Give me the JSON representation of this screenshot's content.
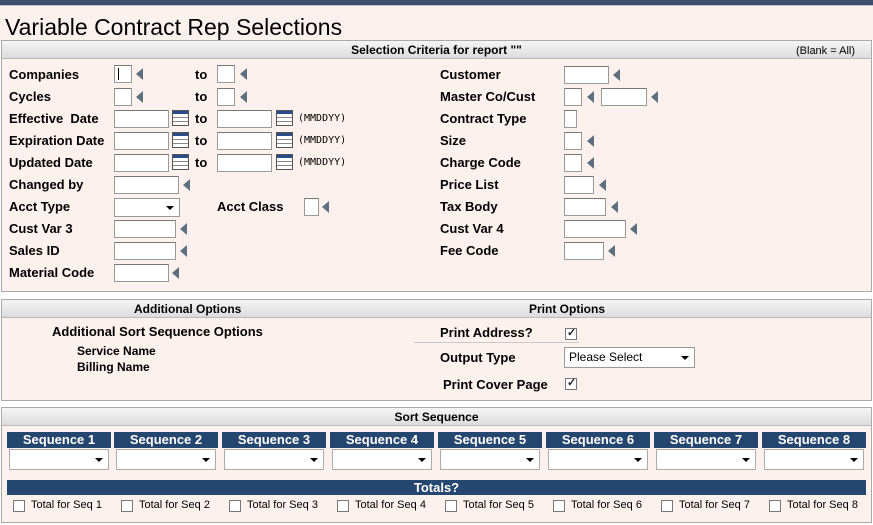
{
  "page_title": "Variable Contract Rep Selections",
  "criteria": {
    "header": "Selection Criteria for report \"\"",
    "blank_note": "(Blank = All)",
    "to": "to",
    "date_format": "(MMDDYY)",
    "labels": {
      "companies": "Companies",
      "cycles": "Cycles",
      "effective_date": "Effective  Date",
      "expiration_date": "Expiration Date",
      "updated_date": "Updated Date",
      "changed_by": "Changed by",
      "acct_type": "Acct Type",
      "acct_class": "Acct Class",
      "cust_var_3": "Cust Var 3",
      "sales_id": "Sales ID",
      "material_code": "Material Code",
      "customer": "Customer",
      "master_co_cust": "Master Co/Cust",
      "contract_type": "Contract Type",
      "size": "Size",
      "charge_code": "Charge Code",
      "price_list": "Price List",
      "tax_body": "Tax Body",
      "cust_var_4": "Cust Var 4",
      "fee_code": "Fee Code"
    }
  },
  "additional": {
    "header": "Additional Options",
    "sort_title": "Additional Sort Sequence Options",
    "items": [
      "Service Name",
      "Billing Name"
    ]
  },
  "print": {
    "header": "Print Options",
    "print_address": "Print Address?",
    "print_address_checked": true,
    "output_type": "Output Type",
    "output_value": "Please Select",
    "print_cover": "Print Cover Page",
    "print_cover_checked": true
  },
  "sort": {
    "header": "Sort Sequence",
    "sequences": [
      "Sequence 1",
      "Sequence 2",
      "Sequence 3",
      "Sequence 4",
      "Sequence 5",
      "Sequence 6",
      "Sequence 7",
      "Sequence 8"
    ],
    "totals_header": "Totals?",
    "totals": [
      "Total for Seq 1",
      "Total for Seq 2",
      "Total for Seq 3",
      "Total for Seq 4",
      "Total for Seq 5",
      "Total for Seq 6",
      "Total for Seq 7",
      "Total for Seq 8"
    ]
  },
  "colors": {
    "accent": "#24466f",
    "panel": "#fcf1ec"
  }
}
